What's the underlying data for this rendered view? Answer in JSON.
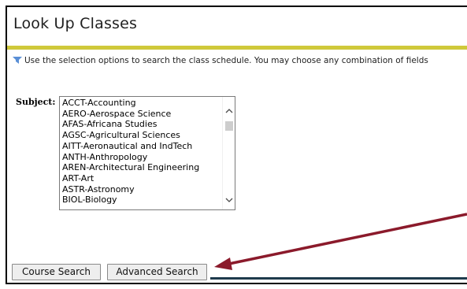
{
  "page": {
    "title": "Look Up Classes",
    "info_text": "Use the selection options to search the class schedule. You may choose any combination of fields"
  },
  "subject": {
    "label": "Subject:",
    "options": [
      "ACCT-Accounting",
      "AERO-Aerospace Science",
      "AFAS-Africana Studies",
      "AGSC-Agricultural Sciences",
      "AITT-Aeronautical and IndTech",
      "ANTH-Anthropology",
      "AREN-Architectural Engineering",
      "ART-Art",
      "ASTR-Astronomy",
      "BIOL-Biology"
    ]
  },
  "buttons": {
    "course_search": "Course Search",
    "advanced_search": "Advanced Search"
  },
  "colors": {
    "rule": "#cfc93a",
    "arrow": "#8b1a2b",
    "bottom_rule": "#1e3a4c"
  },
  "icons": {
    "info": "info-icon",
    "scroll_up": "chevron-up-icon",
    "scroll_down": "chevron-down-icon"
  }
}
